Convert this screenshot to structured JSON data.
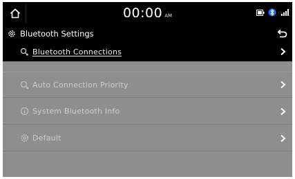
{
  "status_bar": {
    "time": "00:00",
    "ampm": "AM",
    "icons": [
      "home-icon",
      "battery-icon",
      "bluetooth-icon",
      "signal-icon"
    ]
  },
  "header": {
    "title": "Bluetooth Settings",
    "icon": "gear-icon",
    "back_icon": "back-arrow-icon"
  },
  "menu": {
    "items": [
      {
        "label": "Bluetooth Connections",
        "icon": "bluetooth-phone-icon",
        "selected": true
      },
      {
        "label": "Auto Connection Priority",
        "icon": "priority-icon",
        "selected": false
      },
      {
        "label": "System Bluetooth Info",
        "icon": "info-icon",
        "selected": false
      },
      {
        "label": "Default",
        "icon": "reset-gear-icon",
        "selected": false
      }
    ]
  },
  "colors": {
    "background": "#000000",
    "list_background": "#8e8e8e",
    "text": "#ffffff"
  }
}
